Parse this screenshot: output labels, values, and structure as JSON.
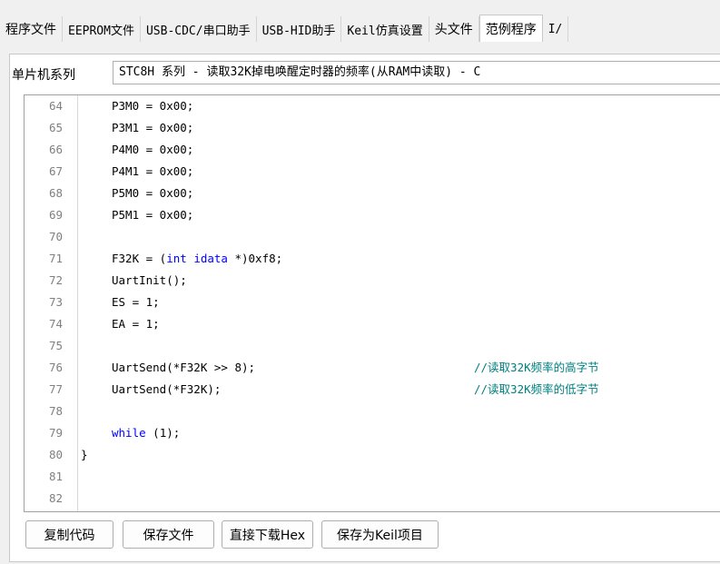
{
  "tabs": [
    {
      "label": "程序文件",
      "mono": false,
      "active": false
    },
    {
      "label": "EEPROM文件",
      "mono": true,
      "active": false
    },
    {
      "label": "USB-CDC/串口助手",
      "mono": true,
      "active": false
    },
    {
      "label": "USB-HID助手",
      "mono": true,
      "active": false
    },
    {
      "label": "Keil仿真设置",
      "mono": true,
      "active": false
    },
    {
      "label": "头文件",
      "mono": false,
      "active": false
    },
    {
      "label": "范例程序",
      "mono": false,
      "active": true
    },
    {
      "label": "I/",
      "mono": true,
      "active": false
    }
  ],
  "series": {
    "label": "单片机系列",
    "selected": "STC8H 系列 - 读取32K掉电唤醒定时器的频率(从RAM中读取) - C"
  },
  "code": [
    {
      "n": "64",
      "segments": [
        {
          "t": "P3M0 = 0x00;",
          "k": false
        }
      ],
      "comment": ""
    },
    {
      "n": "65",
      "segments": [
        {
          "t": "P3M1 = 0x00;",
          "k": false
        }
      ],
      "comment": ""
    },
    {
      "n": "66",
      "segments": [
        {
          "t": "P4M0 = 0x00;",
          "k": false
        }
      ],
      "comment": ""
    },
    {
      "n": "67",
      "segments": [
        {
          "t": "P4M1 = 0x00;",
          "k": false
        }
      ],
      "comment": ""
    },
    {
      "n": "68",
      "segments": [
        {
          "t": "P5M0 = 0x00;",
          "k": false
        }
      ],
      "comment": ""
    },
    {
      "n": "69",
      "segments": [
        {
          "t": "P5M1 = 0x00;",
          "k": false
        }
      ],
      "comment": ""
    },
    {
      "n": "70",
      "segments": [],
      "comment": ""
    },
    {
      "n": "71",
      "segments": [
        {
          "t": "F32K = (",
          "k": false
        },
        {
          "t": "int idata",
          "k": true
        },
        {
          "t": " *)0xf8;",
          "k": false
        }
      ],
      "comment": ""
    },
    {
      "n": "72",
      "segments": [
        {
          "t": "UartInit();",
          "k": false
        }
      ],
      "comment": ""
    },
    {
      "n": "73",
      "segments": [
        {
          "t": "ES = 1;",
          "k": false
        }
      ],
      "comment": ""
    },
    {
      "n": "74",
      "segments": [
        {
          "t": "EA = 1;",
          "k": false
        }
      ],
      "comment": ""
    },
    {
      "n": "75",
      "segments": [],
      "comment": ""
    },
    {
      "n": "76",
      "segments": [
        {
          "t": "UartSend(*F32K >> 8);",
          "k": false
        }
      ],
      "comment": "//读取32K频率的高字节"
    },
    {
      "n": "77",
      "segments": [
        {
          "t": "UartSend(*F32K);",
          "k": false
        }
      ],
      "comment": "//读取32K频率的低字节"
    },
    {
      "n": "78",
      "segments": [],
      "comment": ""
    },
    {
      "n": "79",
      "segments": [
        {
          "t": "while",
          "k": true
        },
        {
          "t": " (1);",
          "k": false
        }
      ],
      "comment": ""
    },
    {
      "n": "80",
      "segments": [
        {
          "t": "}",
          "k": false
        }
      ],
      "comment": "",
      "outdent": true
    },
    {
      "n": "81",
      "segments": [],
      "comment": ""
    },
    {
      "n": "82",
      "segments": [],
      "comment": ""
    }
  ],
  "buttons": {
    "copy_code": "复制代码",
    "save_file": "保存文件",
    "download_hex": "直接下载Hex",
    "save_keil": "保存为Keil项目"
  },
  "colors": {
    "keyword": "#0000ff",
    "comment": "#008080",
    "line_number": "#808080"
  }
}
